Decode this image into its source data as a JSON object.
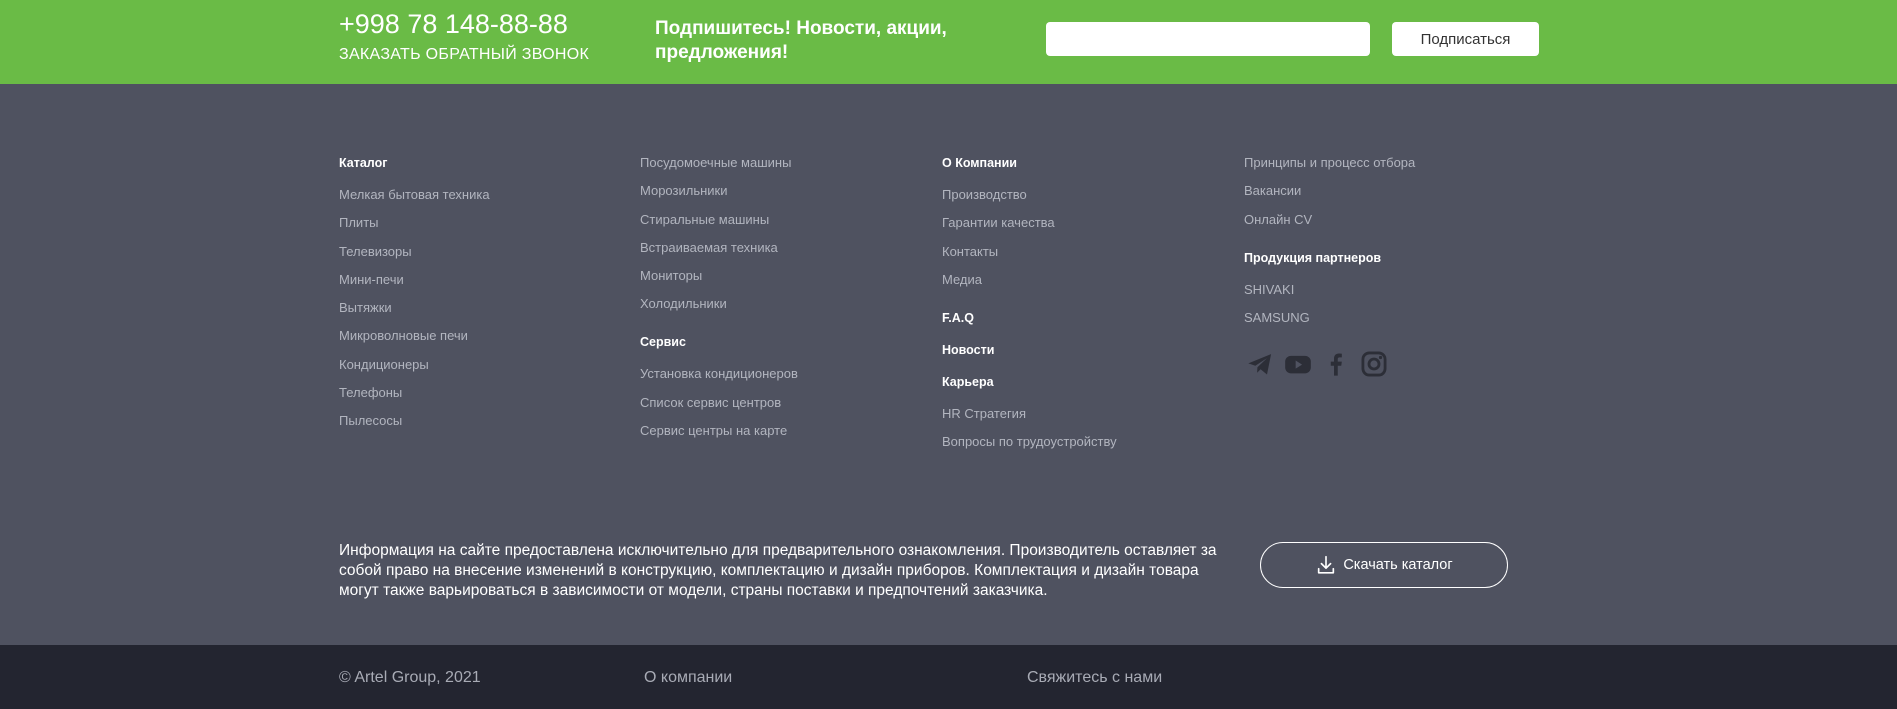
{
  "topbar": {
    "phone": "+998 78 148-88-88",
    "callback": "ЗАКАЗАТЬ ОБРАТНЫЙ ЗВОНОК",
    "subscribe_text": "Подпишитесь! Новости, акции, предложения!",
    "email_value": "",
    "subscribe_button": "Подписаться"
  },
  "footer": {
    "catalog": {
      "heading": "Каталог",
      "items": [
        "Мелкая бытовая техника",
        "Плиты",
        "Телевизоры",
        "Мини-печи",
        "Вытяжки",
        "Микроволновые печи",
        "Кондиционеры",
        "Телефоны",
        "Пылесосы"
      ]
    },
    "catalog2": {
      "items": [
        "Посудомоечные машины",
        "Морозильники",
        "Стиральные машины",
        "Встраиваемая техника",
        "Мониторы",
        "Холодильники"
      ]
    },
    "service": {
      "heading": "Сервис",
      "items": [
        "Установка кондиционеров",
        "Список сервис центров",
        "Сервис центры на карте"
      ]
    },
    "company": {
      "heading": "О Компании",
      "items": [
        "Производство",
        "Гарантии качества",
        "Контакты",
        "Медиа"
      ]
    },
    "faq": "F.A.Q",
    "news": "Новости",
    "career": {
      "heading": "Карьера",
      "items": [
        "HR Стратегия",
        "Вопросы по трудоустройству"
      ]
    },
    "career2": {
      "items": [
        "Принципы и процесс отбора",
        "Вакансии",
        "Онлайн CV"
      ]
    },
    "partners": {
      "heading": "Продукция партнеров",
      "items": [
        "SHIVAKI",
        "SAMSUNG"
      ]
    },
    "socials": [
      "telegram-icon",
      "youtube-icon",
      "facebook-icon",
      "instagram-icon"
    ]
  },
  "disclaimer": "Информация на сайте предоставлена исключительно для предварительного ознакомления. Производитель оставляет за собой право на внесение изменений в конструкцию, комплектацию и дизайн приборов. Комплектация и дизайн товара могут также варьироваться в зависимости от модели, страны поставки и предпочтений заказчика.",
  "catalog_button": "Скачать каталог",
  "bottom": {
    "copyright": "© Artel Group, 2021",
    "about": "О компании",
    "contact": "Свяжитесь с нами"
  },
  "colors": {
    "green": "#6abb46",
    "footer_bg": "#4f5260",
    "bottom_bg": "#232530",
    "icon": "#2c2e37"
  }
}
